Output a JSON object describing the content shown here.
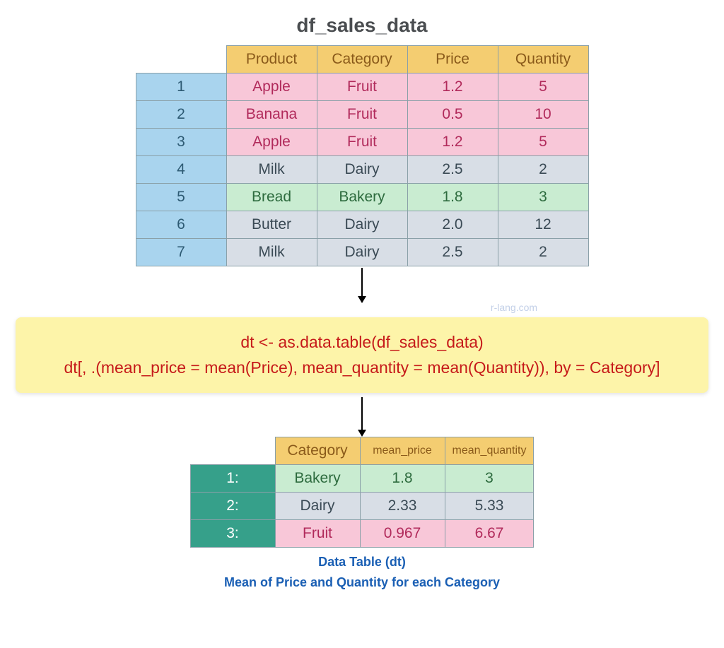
{
  "title": "df_sales_data",
  "watermark": "r-lang.com",
  "code": {
    "line1": "dt <- as.data.table(df_sales_data)",
    "line2": "dt[, .(mean_price = mean(Price), mean_quantity = mean(Quantity)), by = Category]"
  },
  "caption1": "Data Table (dt)",
  "caption2": "Mean of Price and Quantity for each Category",
  "table1": {
    "headers": [
      "Product",
      "Category",
      "Price",
      "Quantity"
    ],
    "rows": [
      {
        "idx": "1",
        "cls": "row-pink",
        "cells": [
          "Apple",
          "Fruit",
          "1.2",
          "5"
        ]
      },
      {
        "idx": "2",
        "cls": "row-pink",
        "cells": [
          "Banana",
          "Fruit",
          "0.5",
          "10"
        ]
      },
      {
        "idx": "3",
        "cls": "row-pink",
        "cells": [
          "Apple",
          "Fruit",
          "1.2",
          "5"
        ]
      },
      {
        "idx": "4",
        "cls": "row-grey",
        "cells": [
          "Milk",
          "Dairy",
          "2.5",
          "2"
        ]
      },
      {
        "idx": "5",
        "cls": "row-green",
        "cells": [
          "Bread",
          "Bakery",
          "1.8",
          "3"
        ]
      },
      {
        "idx": "6",
        "cls": "row-grey",
        "cells": [
          "Butter",
          "Dairy",
          "2.0",
          "12"
        ]
      },
      {
        "idx": "7",
        "cls": "row-grey",
        "cells": [
          "Milk",
          "Dairy",
          "2.5",
          "2"
        ]
      }
    ]
  },
  "table2": {
    "headers": [
      "Category",
      "mean_price",
      "mean_quantity"
    ],
    "rows": [
      {
        "idx": "1:",
        "cls": "row-green",
        "cells": [
          "Bakery",
          "1.8",
          "3"
        ]
      },
      {
        "idx": "2:",
        "cls": "row-grey",
        "cells": [
          "Dairy",
          "2.33",
          "5.33"
        ]
      },
      {
        "idx": "3:",
        "cls": "row-pink",
        "cells": [
          "Fruit",
          "0.967",
          "6.67"
        ]
      }
    ]
  },
  "chart_data": {
    "type": "table",
    "title": "df_sales_data aggregated by Category (mean of Price and Quantity)",
    "source_table": {
      "columns": [
        "Product",
        "Category",
        "Price",
        "Quantity"
      ],
      "rows": [
        [
          "Apple",
          "Fruit",
          1.2,
          5
        ],
        [
          "Banana",
          "Fruit",
          0.5,
          10
        ],
        [
          "Apple",
          "Fruit",
          1.2,
          5
        ],
        [
          "Milk",
          "Dairy",
          2.5,
          2
        ],
        [
          "Bread",
          "Bakery",
          1.8,
          3
        ],
        [
          "Butter",
          "Dairy",
          2.0,
          12
        ],
        [
          "Milk",
          "Dairy",
          2.5,
          2
        ]
      ]
    },
    "result_table": {
      "columns": [
        "Category",
        "mean_price",
        "mean_quantity"
      ],
      "rows": [
        [
          "Bakery",
          1.8,
          3
        ],
        [
          "Dairy",
          2.33,
          5.33
        ],
        [
          "Fruit",
          0.967,
          6.67
        ]
      ]
    }
  }
}
